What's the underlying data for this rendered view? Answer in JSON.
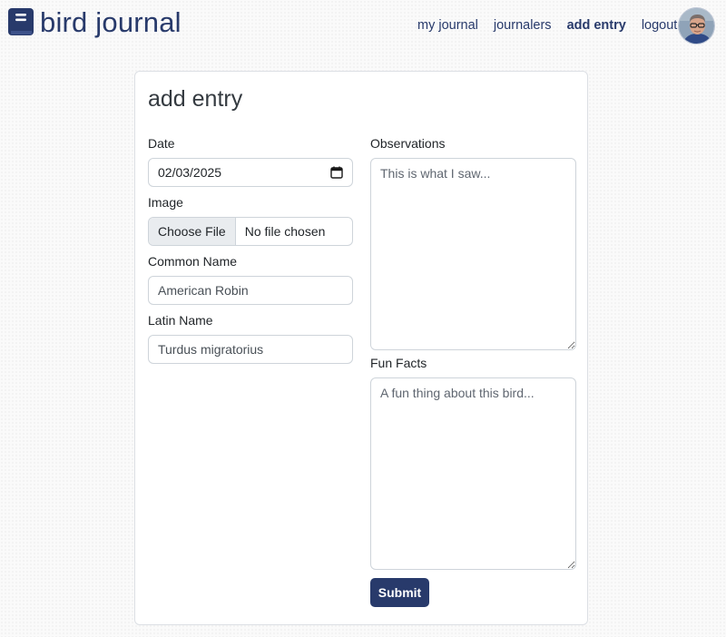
{
  "brand": {
    "name": "bird journal",
    "icon": "book-icon"
  },
  "nav": {
    "items": [
      {
        "label": "my journal"
      },
      {
        "label": "journalers"
      },
      {
        "label": "add entry",
        "active": true
      },
      {
        "label": "logout"
      }
    ],
    "avatar": "user-avatar"
  },
  "form": {
    "title": "add entry",
    "date": {
      "label": "Date",
      "value": "02/03/2025",
      "icon": "calendar-icon"
    },
    "image": {
      "label": "Image",
      "button_label": "Choose File",
      "status": "No file chosen"
    },
    "common_name": {
      "label": "Common Name",
      "value": "American Robin"
    },
    "latin_name": {
      "label": "Latin Name",
      "value": "Turdus migratorius"
    },
    "observations": {
      "label": "Observations",
      "placeholder": "This is what I saw..."
    },
    "fun_facts": {
      "label": "Fun Facts",
      "placeholder": "A fun thing about this bird..."
    },
    "submit_label": "Submit"
  },
  "colors": {
    "brand": "#283a6b",
    "background": "#fafafa",
    "card": "#ffffff",
    "border": "#dcdfe4"
  }
}
